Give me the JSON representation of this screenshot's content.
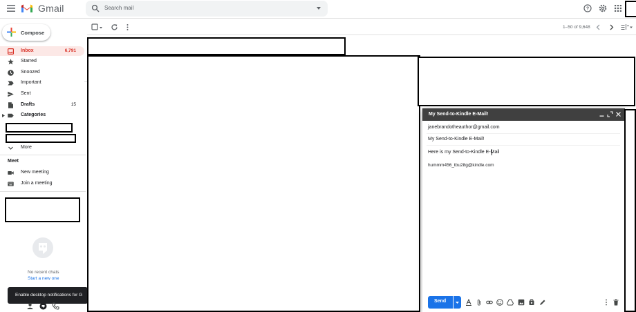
{
  "app": {
    "name": "Gmail",
    "brand_colors": {
      "red": "#EA4335",
      "blue": "#4285F4",
      "green": "#34A853",
      "yellow": "#FBBC04"
    }
  },
  "search": {
    "placeholder": "Search mail"
  },
  "compose_button": {
    "label": "Compose"
  },
  "sidebar": {
    "items": [
      {
        "label": "Inbox",
        "count": "6,791",
        "icon": "inbox-icon",
        "active": true
      },
      {
        "label": "Starred",
        "count": "",
        "icon": "star-icon"
      },
      {
        "label": "Snoozed",
        "count": "",
        "icon": "clock-icon"
      },
      {
        "label": "Important",
        "count": "",
        "icon": "important-icon"
      },
      {
        "label": "Sent",
        "count": "",
        "icon": "send-icon"
      },
      {
        "label": "Drafts",
        "count": "15",
        "icon": "draft-icon"
      },
      {
        "label": "Categories",
        "count": "",
        "icon": "label-icon"
      }
    ],
    "more_label": "More",
    "meet": {
      "title": "Meet",
      "items": [
        {
          "label": "New meeting",
          "icon": "videocam-icon"
        },
        {
          "label": "Join a meeting",
          "icon": "keyboard-icon"
        }
      ]
    }
  },
  "chat": {
    "empty_text": "No recent chats",
    "start_link": "Start a new one"
  },
  "toast": {
    "text": "Enable desktop notifications for G"
  },
  "toolbar": {
    "range": "1–50 of 9,648"
  },
  "compose_window": {
    "title": "My Send-to-Kindle E-Mail!",
    "from": "janebrandotheauthor@gmail.com",
    "subject": "My Send-to-Kindle E-Mail!",
    "body_line1": "Here is my Send-to-Kindle E-Mail",
    "body_line2": "hummm456_tbu28g@kindle.com",
    "send_label": "Send"
  }
}
